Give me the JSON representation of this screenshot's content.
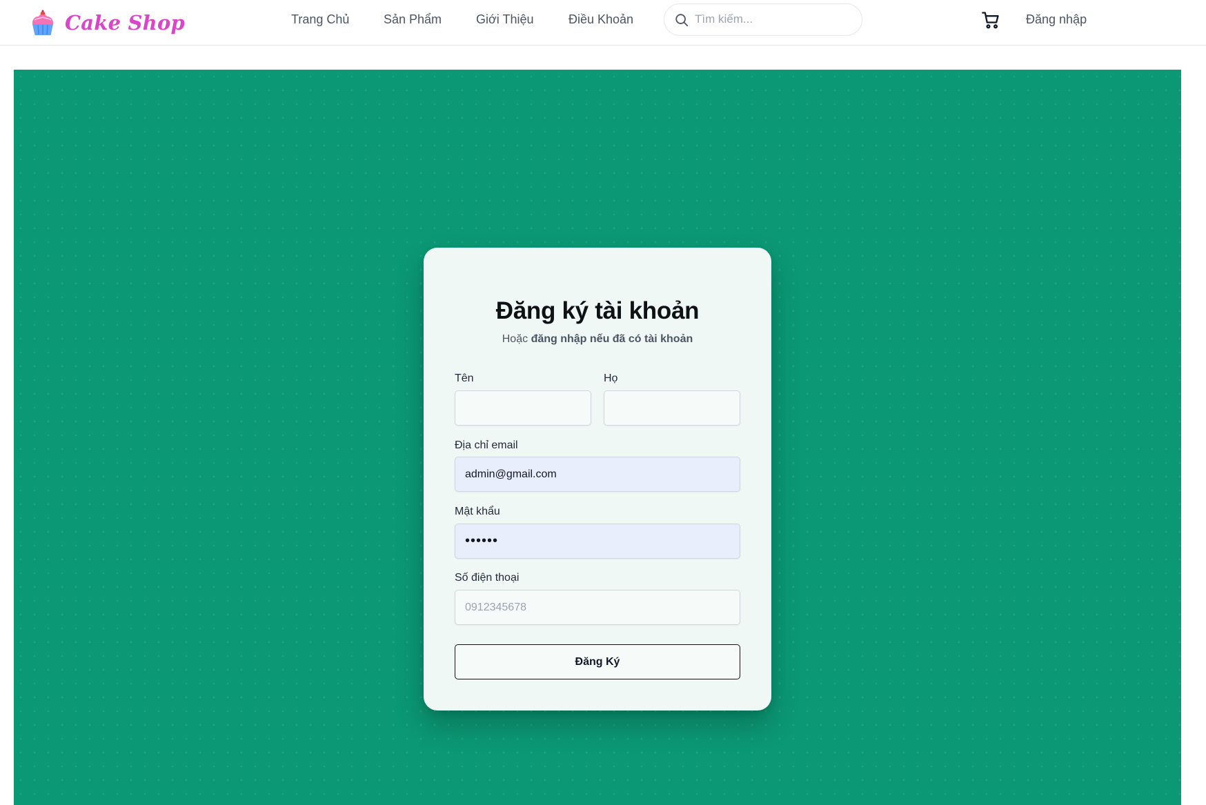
{
  "brand": {
    "name": "Cake Shop",
    "icon": "cupcake-icon",
    "color": "#d946c8"
  },
  "nav": {
    "items": [
      {
        "label": "Trang Chủ"
      },
      {
        "label": "Sản Phẩm"
      },
      {
        "label": "Giới Thiệu"
      },
      {
        "label": "Điều Khoản"
      }
    ]
  },
  "search": {
    "icon": "search-icon",
    "placeholder": "Tìm kiếm...",
    "value": ""
  },
  "header_actions": {
    "cart_icon": "shopping-cart-icon",
    "login_label": "Đăng nhập"
  },
  "banner": {
    "color": "#0b9874"
  },
  "form": {
    "title": "Đăng ký tài khoản",
    "subtitle_prefix": "Hoặc",
    "subtitle_link": "đăng nhập nếu đã có tài khoản",
    "first_name": {
      "label": "Tên",
      "value": "",
      "placeholder": ""
    },
    "last_name": {
      "label": "Họ",
      "value": "",
      "placeholder": ""
    },
    "email": {
      "label": "Địa chỉ email",
      "value": "admin@gmail.com"
    },
    "password": {
      "label": "Mật khẩu",
      "value": "••••••"
    },
    "phone": {
      "label": "Số điện thoại",
      "value": "",
      "placeholder": "0912345678"
    },
    "submit_label": "Đăng Ký"
  }
}
